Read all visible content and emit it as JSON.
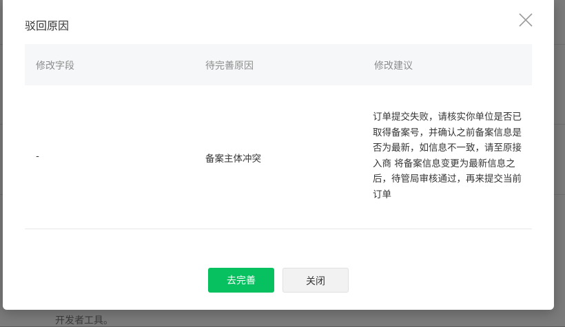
{
  "dialog": {
    "title": "驳回原因",
    "table": {
      "headers": [
        "修改字段",
        "待完善原因",
        "修改建议"
      ],
      "rows": [
        {
          "field": "-",
          "reason": "备案主体冲突",
          "suggestion": "订单提交失败，请核实你单位是否已取得备案号，并确认之前备案信息是否为最新，如信息不一致，请至原接入商 将备案信息变更为最新信息之后，待管局审核通过，再来提交当前订单"
        }
      ]
    },
    "buttons": {
      "complete": "去完善",
      "close": "关闭"
    }
  },
  "background": {
    "partial_text": "开发者工具。"
  }
}
